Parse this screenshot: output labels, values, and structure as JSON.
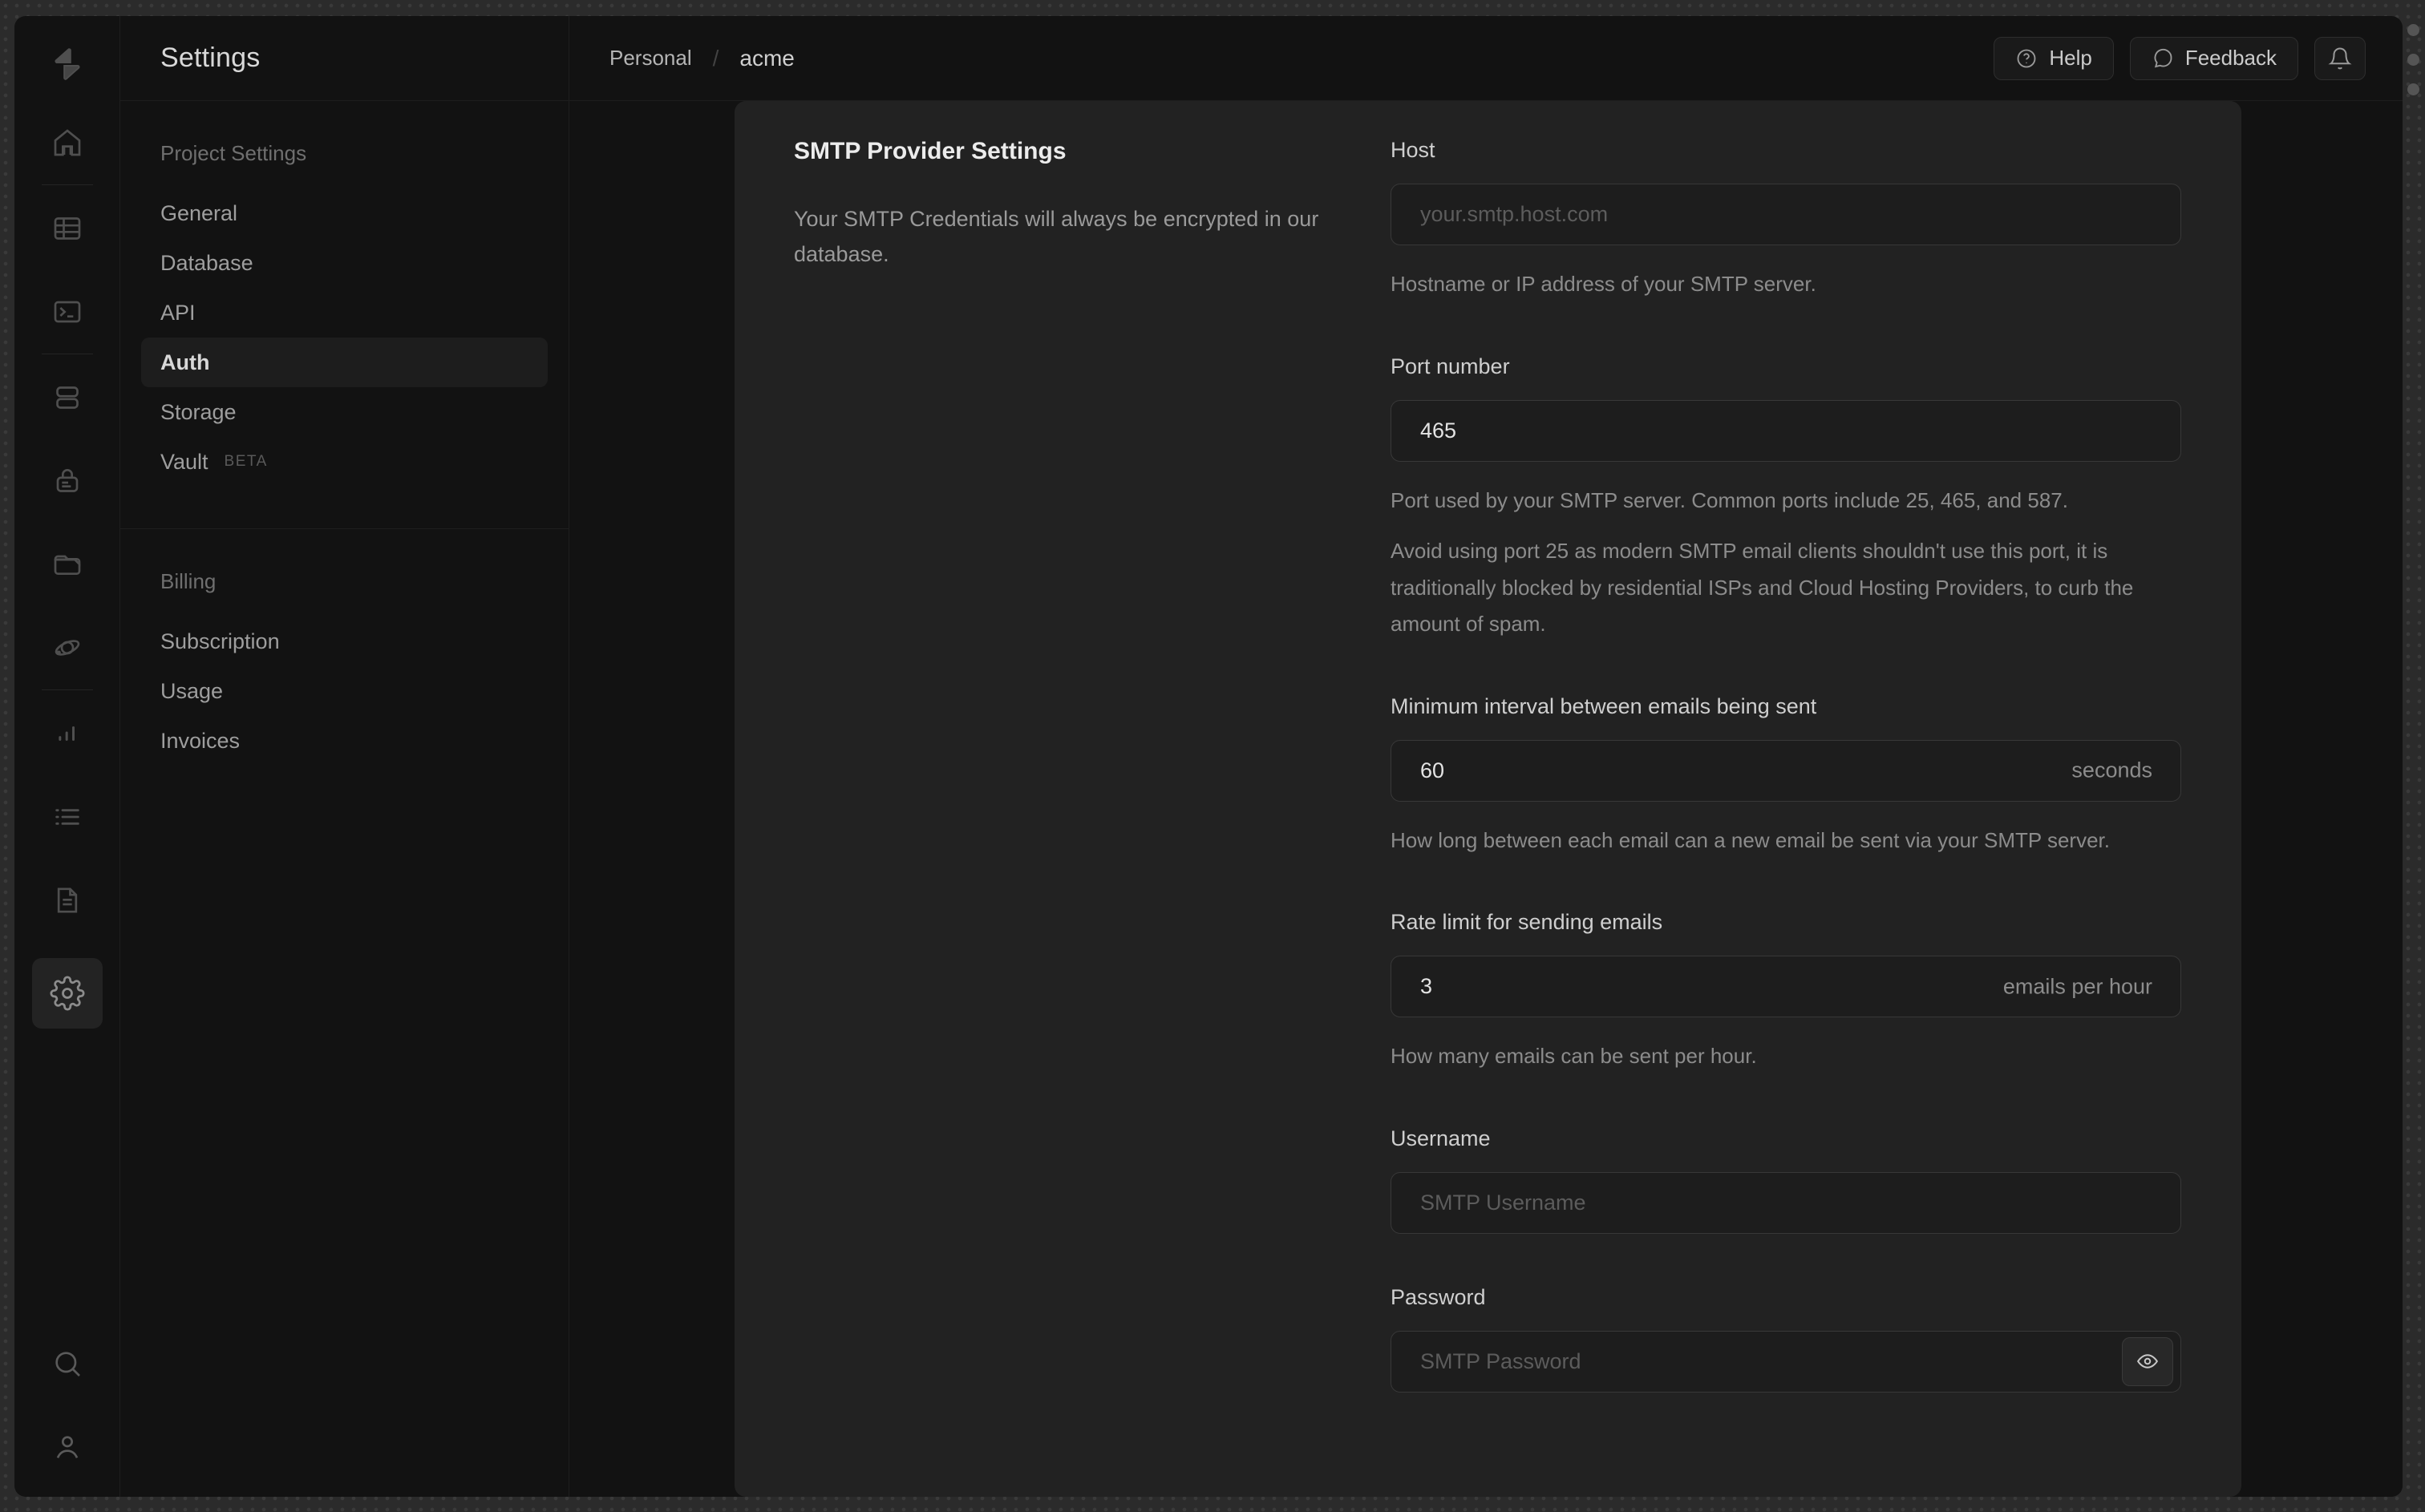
{
  "header": {
    "breadcrumb": {
      "org": "Personal",
      "separator": "/",
      "project": "acme"
    },
    "actions": {
      "help": "Help",
      "feedback": "Feedback",
      "bell_icon": "bell-icon"
    }
  },
  "sidebar": {
    "panel_title": "Settings",
    "rail_icons": [
      "supabase-logo",
      "home-icon",
      "table-editor-icon",
      "sql-editor-icon",
      "database-icon",
      "auth-lock-icon",
      "storage-folder-icon",
      "edge-functions-icon",
      "reports-chart-icon",
      "logs-list-icon",
      "api-docs-icon",
      "settings-gear-icon",
      "search-icon",
      "user-icon"
    ],
    "groups": [
      {
        "label": "Project Settings",
        "items": [
          {
            "label": "General"
          },
          {
            "label": "Database"
          },
          {
            "label": "API"
          },
          {
            "label": "Auth",
            "active": true
          },
          {
            "label": "Storage"
          },
          {
            "label": "Vault",
            "badge": "BETA"
          }
        ]
      },
      {
        "label": "Billing",
        "items": [
          {
            "label": "Subscription"
          },
          {
            "label": "Usage"
          },
          {
            "label": "Invoices"
          }
        ]
      }
    ]
  },
  "content": {
    "section": {
      "title": "SMTP Provider Settings",
      "description": "Your SMTP Credentials will always be encrypted in our database."
    },
    "fields": {
      "host": {
        "label": "Host",
        "placeholder": "your.smtp.host.com",
        "help": "Hostname or IP address of your SMTP server."
      },
      "port": {
        "label": "Port number",
        "value": "465",
        "help": "Port used by your SMTP server. Common ports include 25, 465, and 587.",
        "note": "Avoid using port 25 as modern SMTP email clients shouldn't use this port, it is traditionally blocked by residential ISPs and Cloud Hosting Providers, to curb the amount of spam."
      },
      "interval": {
        "label": "Minimum interval between emails being sent",
        "value": "60",
        "unit": "seconds",
        "help": "How long between each email can a new email be sent via your SMTP server."
      },
      "rate": {
        "label": "Rate limit for sending emails",
        "value": "3",
        "unit": "emails per hour",
        "help": "How many emails can be sent per hour."
      },
      "username": {
        "label": "Username",
        "placeholder": "SMTP Username"
      },
      "password": {
        "label": "Password",
        "placeholder": "SMTP Password"
      }
    }
  },
  "colors": {
    "frame_background": "#2b2b2b",
    "app_background": "#121212",
    "card_background": "#222222",
    "input_background": "#1d1d1d",
    "border": "#1e1e1e",
    "input_border": "#383838",
    "text_primary": "#ececec",
    "text_muted": "#8c8c8c",
    "active_item_background": "#1d1d1d"
  }
}
